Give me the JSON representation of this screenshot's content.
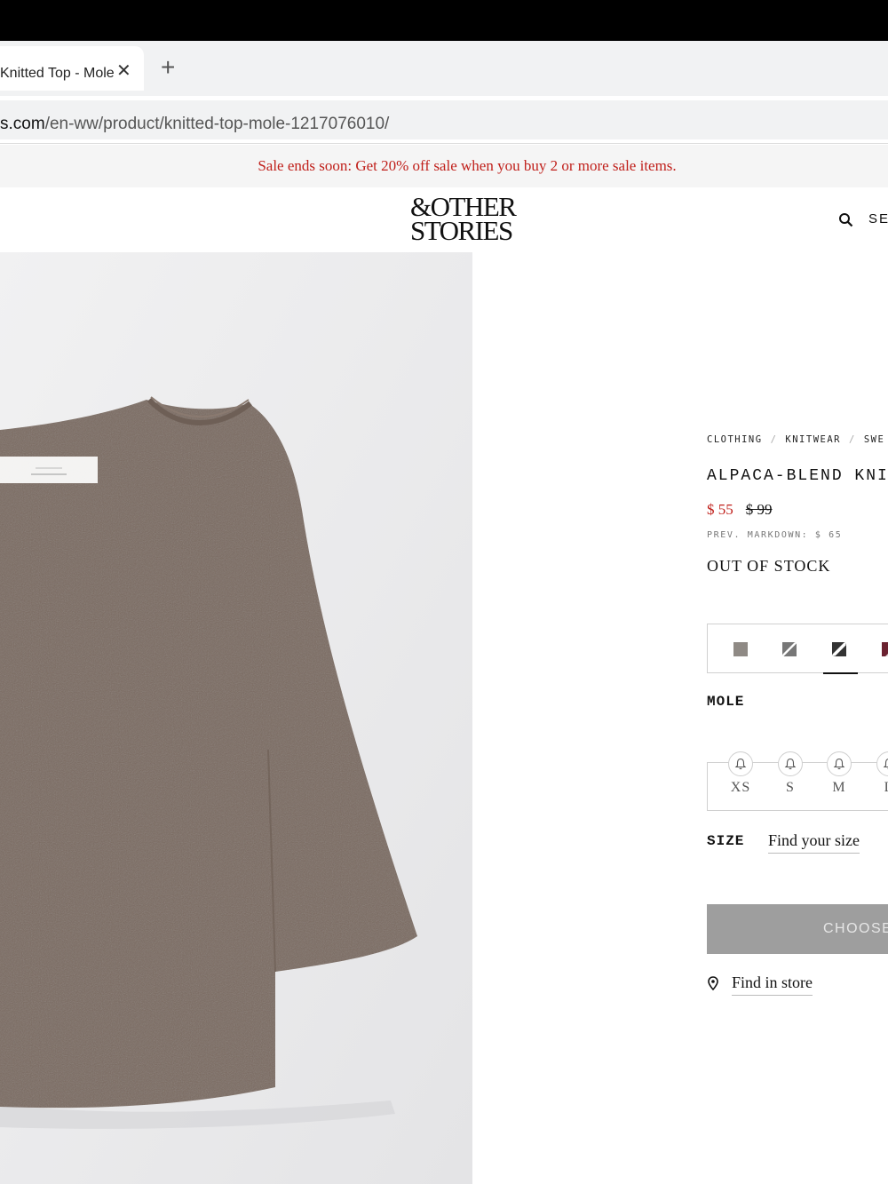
{
  "browser": {
    "tab_title": "Knitted Top - Mole",
    "close_glyph": "✕",
    "new_tab_glyph": "+",
    "url_host": "s.com",
    "url_path": "/en-ww/product/knitted-top-mole-1217076010/"
  },
  "promo": {
    "text": "Sale ends soon: Get 20% off sale when you buy 2 or more sale items.",
    "color": "#c0201b"
  },
  "header": {
    "logo_line1": "&OTHER",
    "logo_line2": "STORIES",
    "search_label": "SEA",
    "search_icon": "search-icon"
  },
  "product": {
    "breadcrumb": [
      "CLOTHING",
      "KNITWEAR",
      "SWE"
    ],
    "breadcrumb_sep": "/",
    "title": "ALPACA-BLEND KNITT",
    "sale_price": "$ 55",
    "original_price": "$ 99",
    "prev_markdown": "PREV. MARKDOWN: $ 65",
    "stock_status": "OUT OF STOCK",
    "swatches": [
      {
        "name": "mole",
        "color": "#8f8a85",
        "style": "solid"
      },
      {
        "name": "grey-white",
        "color": "#777777",
        "style": "split"
      },
      {
        "name": "black-white",
        "color": "#333333",
        "style": "split"
      },
      {
        "name": "burgundy",
        "color": "#6b2230",
        "style": "split"
      }
    ],
    "selected_color": "MOLE",
    "sizes": [
      "XS",
      "S",
      "M",
      "L"
    ],
    "size_label": "SIZE",
    "find_size_label": "Find your size",
    "choose_button": "CHOOSE",
    "find_in_store": "Find in store",
    "sweater_color": "#7a6a60"
  }
}
